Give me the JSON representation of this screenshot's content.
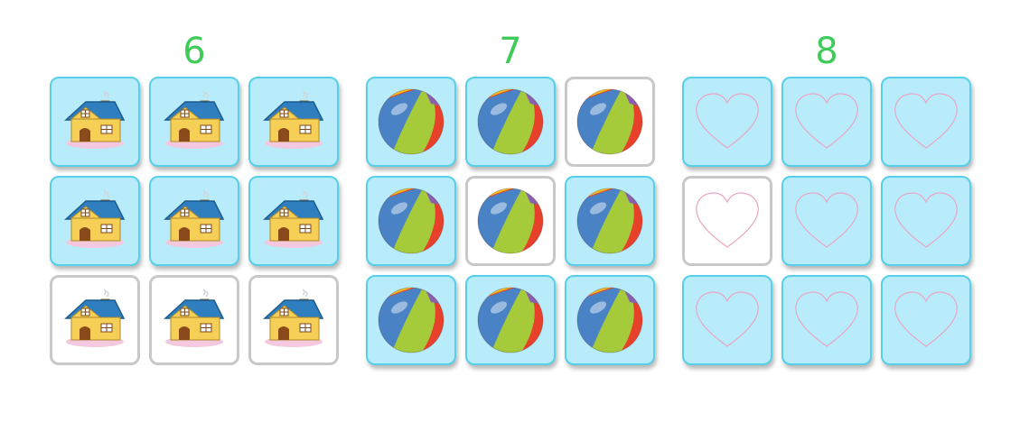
{
  "groups": [
    {
      "label": "6",
      "icon": "house-icon",
      "tiles": [
        "filled",
        "filled",
        "filled",
        "filled",
        "filled",
        "filled",
        "empty",
        "empty",
        "empty"
      ]
    },
    {
      "label": "7",
      "icon": "beach-ball-icon",
      "tiles": [
        "filled",
        "filled",
        "empty",
        "filled",
        "empty",
        "filled",
        "filled",
        "filled",
        "filled"
      ]
    },
    {
      "label": "8",
      "icon": "heart-icon",
      "tiles": [
        "filled",
        "filled",
        "filled",
        "empty",
        "filled",
        "filled",
        "filled",
        "filled",
        "filled"
      ]
    }
  ],
  "colors": {
    "number_green": "#3ecb5a",
    "tile_fill": "#b9ecfb",
    "tile_border": "#56d0ea",
    "empty_border": "#c8c8c8",
    "heart_stroke": "#e8a6c4"
  }
}
